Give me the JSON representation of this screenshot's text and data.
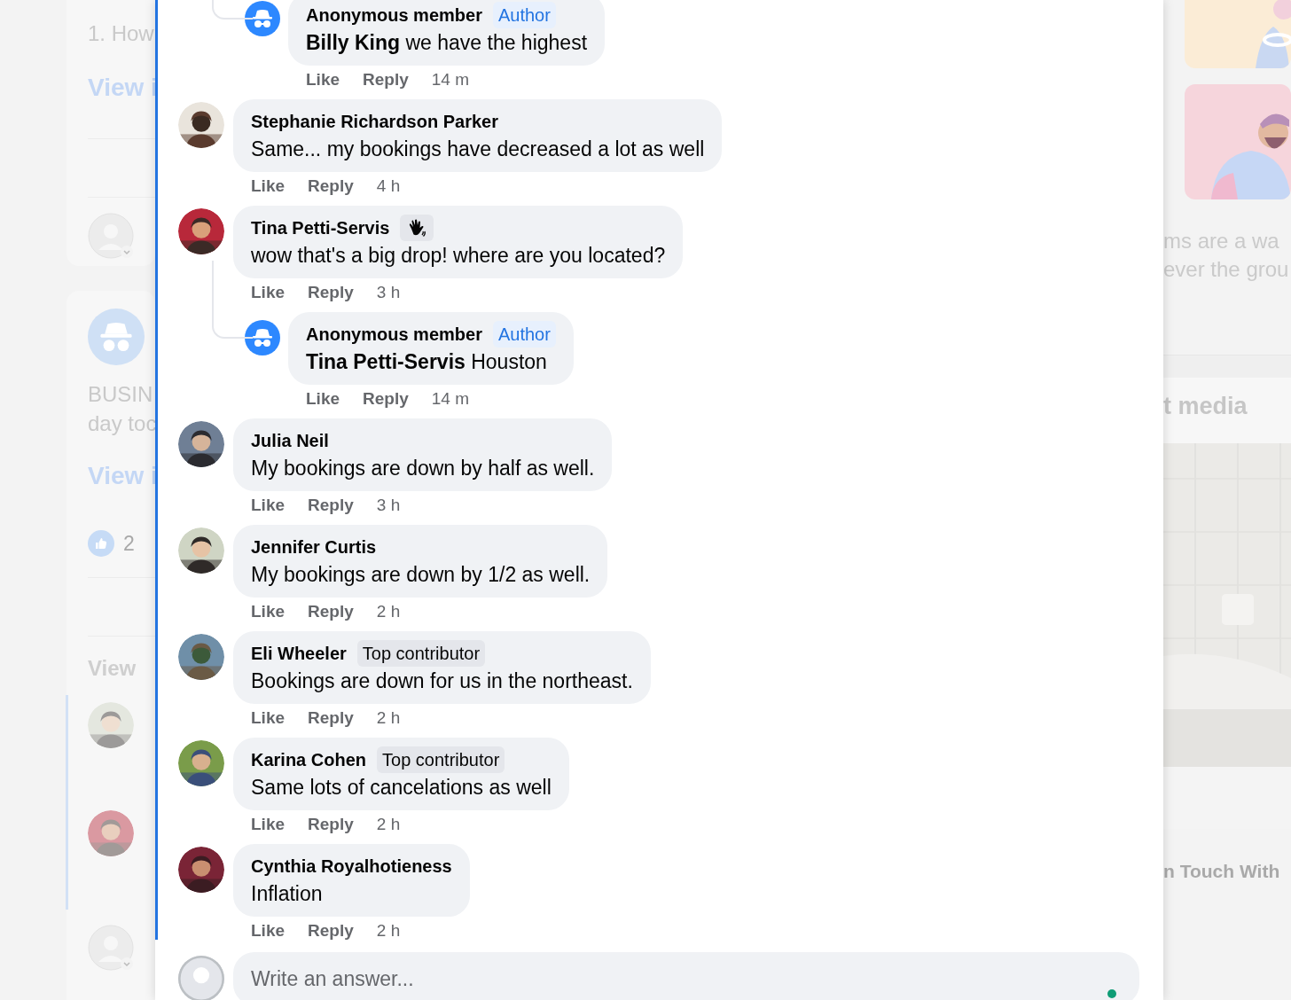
{
  "background": {
    "card_1": {
      "text": "1. How",
      "link": "View i"
    },
    "card_2": {
      "text_lines": [
        "BUSIN",
        "day toc"
      ],
      "link": "View i",
      "like_count": "2",
      "more_link": "View"
    },
    "right": {
      "text_lines": [
        "ms are a wa",
        "ever the grou"
      ],
      "heading": "t media",
      "footer_heading": "n Touch With"
    }
  },
  "thread": {
    "top_replies": [
      {
        "author": "Anonymous member",
        "kind": "anonymous",
        "badges": [
          {
            "kind": "author",
            "label": "Author"
          }
        ],
        "text": "**Billy King** we have the highest",
        "like": "Like",
        "reply": "Reply",
        "time": "14 m"
      }
    ],
    "comments": [
      {
        "author": "Stephanie Richardson Parker",
        "text": "Same... my bookings have decreased a lot as well",
        "like": "Like",
        "reply": "Reply",
        "time": "4 h"
      },
      {
        "author": "Tina Petti-Servis",
        "badges": [
          {
            "kind": "icon"
          }
        ],
        "text": "wow that's a big drop! where are you located?",
        "like": "Like",
        "reply": "Reply",
        "time": "3 h",
        "replies": [
          {
            "author": "Anonymous member",
            "kind": "anonymous",
            "badges": [
              {
                "kind": "author",
                "label": "Author"
              }
            ],
            "text": "**Tina Petti-Servis** Houston",
            "like": "Like",
            "reply": "Reply",
            "time": "14 m"
          }
        ]
      },
      {
        "author": "Julia Neil",
        "text": "My bookings are down by half as well.",
        "like": "Like",
        "reply": "Reply",
        "time": "3 h"
      },
      {
        "author": "Jennifer Curtis",
        "text": "My bookings are down by 1/2 as well.",
        "like": "Like",
        "reply": "Reply",
        "time": "2 h"
      },
      {
        "author": "Eli Wheeler",
        "badges": [
          {
            "kind": "plain",
            "label": "Top contributor"
          }
        ],
        "text": "Bookings are down for us in the northeast.",
        "like": "Like",
        "reply": "Reply",
        "time": "2 h"
      },
      {
        "author": "Karina Cohen",
        "badges": [
          {
            "kind": "plain",
            "label": "Top contributor"
          }
        ],
        "text": "Same lots of cancelations as well",
        "like": "Like",
        "reply": "Reply",
        "time": "2 h"
      },
      {
        "author": "Cynthia Royalhotieness",
        "text": "Inflation",
        "like": "Like",
        "reply": "Reply",
        "time": "2 h"
      }
    ]
  },
  "composer": {
    "placeholder": "Write an answer..."
  }
}
